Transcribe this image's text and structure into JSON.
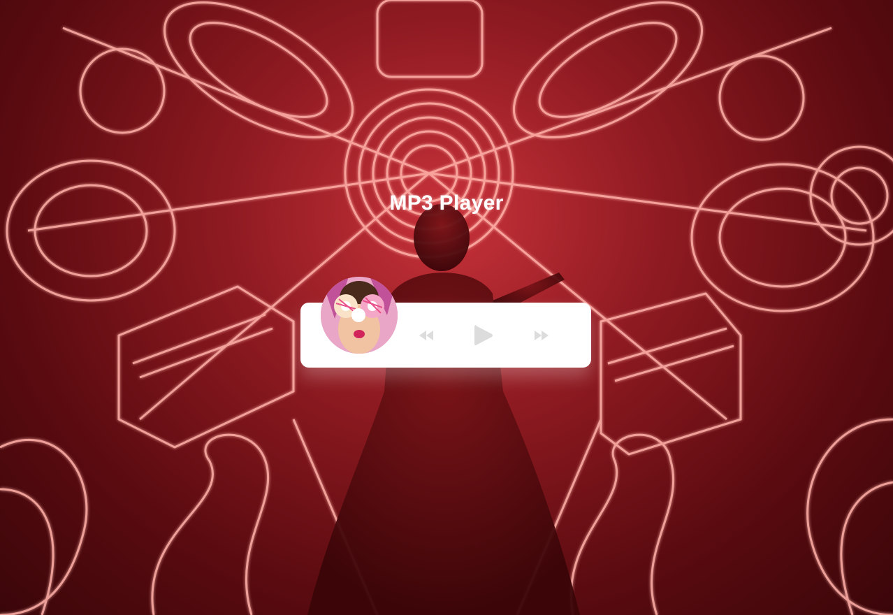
{
  "page": {
    "title": "MP3 Player"
  },
  "player": {
    "album_art": "album-cover-image",
    "controls": [
      {
        "name": "previous",
        "icon": "backward-icon"
      },
      {
        "name": "play",
        "icon": "play-icon"
      },
      {
        "name": "next",
        "icon": "forward-icon"
      }
    ]
  },
  "colors": {
    "background_accent": "#c8323a",
    "neon": "#ff8a8a",
    "player_bg": "#ffffff",
    "control_icon": "#dcdcdc"
  }
}
